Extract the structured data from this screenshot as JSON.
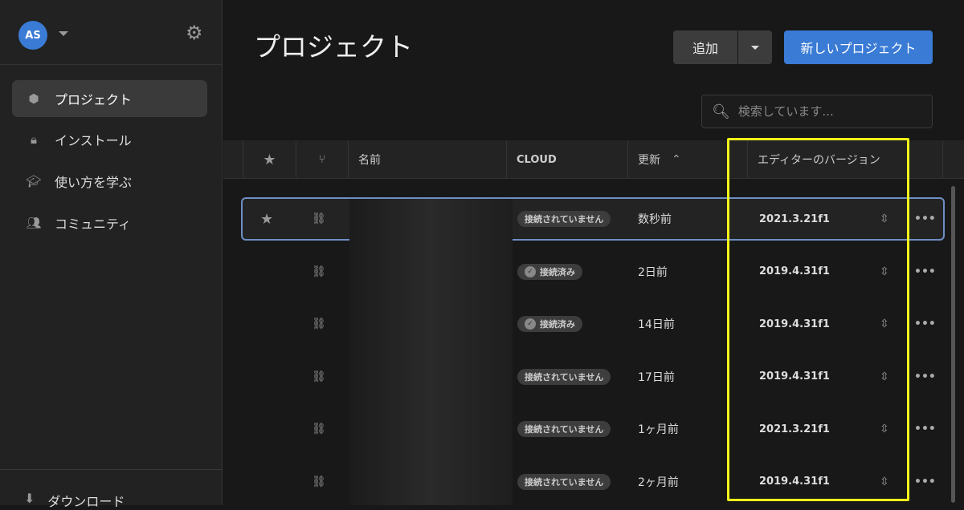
{
  "sidebar": {
    "avatar_initials": "AS",
    "items": [
      {
        "label": "プロジェクト",
        "icon": "cube-icon",
        "active": true
      },
      {
        "label": "インストール",
        "icon": "lock-icon",
        "active": false
      },
      {
        "label": "使い方を学ぶ",
        "icon": "graduation-cap-icon",
        "active": false
      },
      {
        "label": "コミュニティ",
        "icon": "people-icon",
        "active": false
      }
    ],
    "download_label": "ダウンロード"
  },
  "header": {
    "title": "プロジェクト",
    "add_label": "追加",
    "new_project_label": "新しいプロジェクト",
    "search_placeholder": "検索しています..."
  },
  "table": {
    "columns": {
      "name": "名前",
      "cloud": "CLOUD",
      "updated": "更新",
      "editor_version": "エディターのバージョン"
    },
    "rows": [
      {
        "starred": true,
        "cloud": "接続されていません",
        "connected": false,
        "updated": "数秒前",
        "version": "2021.3.21f1",
        "selected": true
      },
      {
        "starred": false,
        "cloud": "接続済み",
        "connected": true,
        "updated": "2日前",
        "version": "2019.4.31f1"
      },
      {
        "starred": false,
        "cloud": "接続済み",
        "connected": true,
        "updated": "14日前",
        "version": "2019.4.31f1"
      },
      {
        "starred": false,
        "cloud": "接続されていません",
        "connected": false,
        "updated": "17日前",
        "version": "2019.4.31f1"
      },
      {
        "starred": false,
        "cloud": "接続されていません",
        "connected": false,
        "updated": "1ヶ月前",
        "version": "2021.3.21f1"
      },
      {
        "starred": false,
        "cloud": "接続されていません",
        "connected": false,
        "updated": "2ヶ月前",
        "version": "2019.4.31f1"
      }
    ]
  },
  "colors": {
    "accent": "#3a7bd5",
    "highlight": "#f2ff1a",
    "selection": "#6d8fc4"
  }
}
